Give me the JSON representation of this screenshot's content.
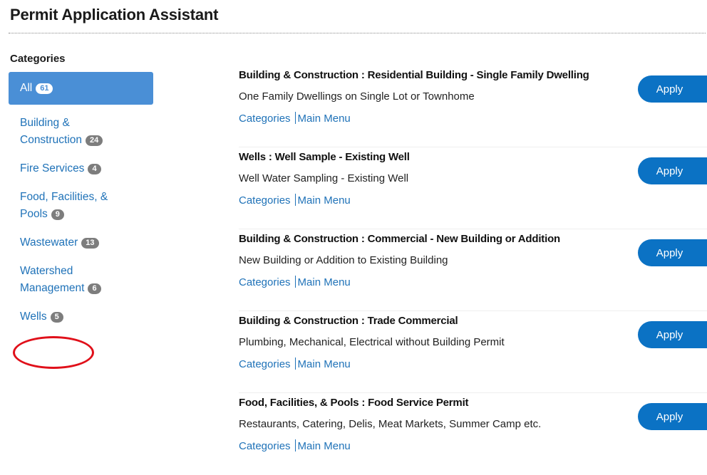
{
  "header": {
    "title": "Permit Application Assistant"
  },
  "sidebar": {
    "heading": "Categories",
    "items": [
      {
        "label": "All",
        "count": "61",
        "active": true
      },
      {
        "label": "Building &",
        "label2": "Construction",
        "count": "24"
      },
      {
        "label": "Fire Services",
        "count": "4"
      },
      {
        "label": "Food, Facilities, &",
        "label2": "Pools",
        "count": "9"
      },
      {
        "label": "Wastewater",
        "count": "13"
      },
      {
        "label": "Watershed",
        "label2": "Management",
        "count": "6"
      },
      {
        "label": "Wells",
        "count": "5",
        "highlighted": true
      }
    ]
  },
  "results": [
    {
      "title": "Building & Construction : Residential Building - Single Family Dwelling",
      "description": "One Family Dwellings on Single Lot or Townhome",
      "link_categories": "Categories",
      "link_main_menu": "Main Menu",
      "apply_label": "Apply"
    },
    {
      "title": "Wells : Well Sample - Existing Well",
      "description": "Well Water Sampling - Existing Well",
      "link_categories": "Categories",
      "link_main_menu": "Main Menu",
      "apply_label": "Apply"
    },
    {
      "title": "Building & Construction : Commercial - New Building or Addition",
      "description": "New Building or Addition to Existing Building",
      "link_categories": "Categories",
      "link_main_menu": "Main Menu",
      "apply_label": "Apply"
    },
    {
      "title": "Building & Construction : Trade Commercial",
      "description": "Plumbing, Mechanical, Electrical without Building Permit",
      "link_categories": "Categories",
      "link_main_menu": "Main Menu",
      "apply_label": "Apply"
    },
    {
      "title": "Food, Facilities, & Pools : Food Service Permit",
      "description": "Restaurants, Catering, Delis, Meat Markets, Summer Camp etc.",
      "link_categories": "Categories",
      "link_main_menu": "Main Menu",
      "apply_label": "Apply"
    }
  ],
  "colors": {
    "accent": "#0b72c4",
    "active_category": "#4a8fd6",
    "link": "#1f72b8",
    "badge": "#7d7d7d",
    "highlight_circle": "#e0101a"
  }
}
